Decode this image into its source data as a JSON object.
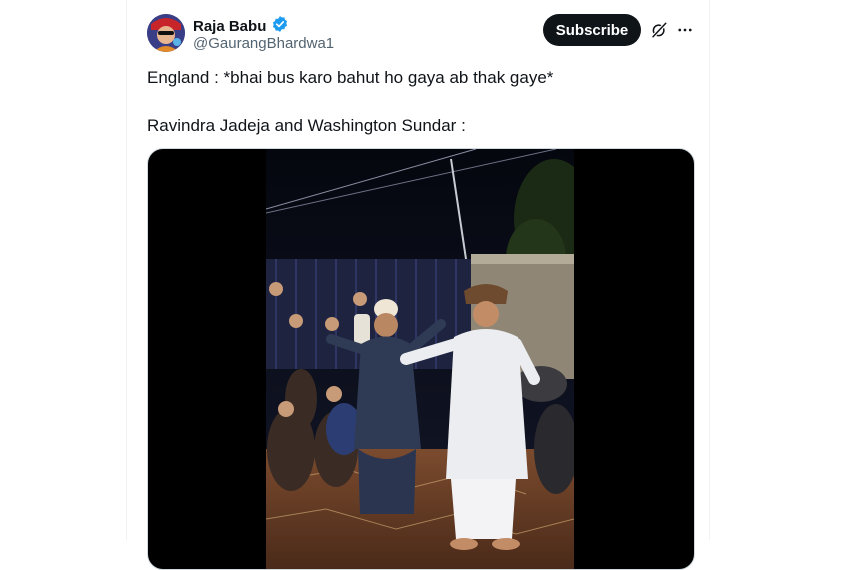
{
  "author": {
    "display_name": "Raja Babu",
    "handle": "@GaurangBhardwa1",
    "verified_icon": "verified-badge-icon"
  },
  "actions": {
    "subscribe_label": "Subscribe",
    "grok_icon": "grok-icon",
    "more_icon": "more-options-icon"
  },
  "tweet": {
    "line1": "England : *bhai bus karo bahut ho gaya ab thak gaye*",
    "line2": "Ravindra Jadeja and Washington Sundar :"
  },
  "colors": {
    "text": "#0f1419",
    "secondary": "#536471",
    "verified": "#1d9bf0",
    "subscribe_bg": "#0f1419",
    "media_bg": "#000000"
  }
}
